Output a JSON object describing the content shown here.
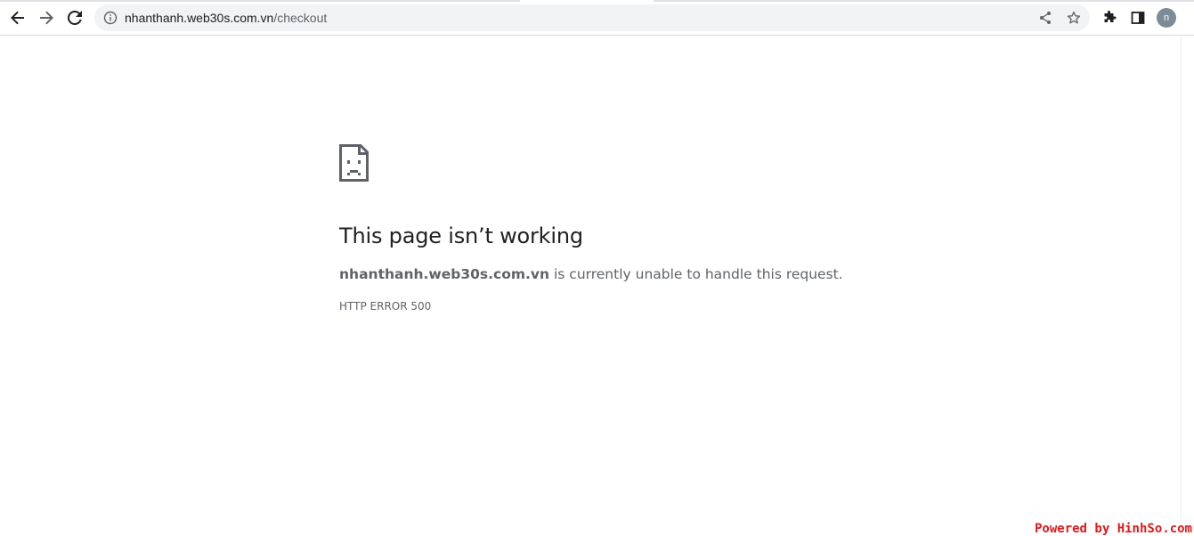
{
  "browser": {
    "url_host": "nhanthanh.web30s.com.vn",
    "url_path": "/checkout",
    "profile_initial": "n",
    "icons": {
      "back": "arrow-left-icon",
      "forward": "arrow-right-icon",
      "reload": "reload-icon",
      "site_info": "info-icon",
      "share": "share-icon",
      "bookmark": "star-icon",
      "extensions": "puzzle-icon",
      "side_panel": "side-panel-icon"
    }
  },
  "error": {
    "icon": "sad-page-icon",
    "title": "This page isn’t working",
    "host": "nhanthanh.web30s.com.vn",
    "message": " is currently unable to handle this request.",
    "code": "HTTP ERROR 500"
  },
  "watermark": {
    "text": "Powered by HinhSo.com",
    "color": "#e0191b"
  }
}
